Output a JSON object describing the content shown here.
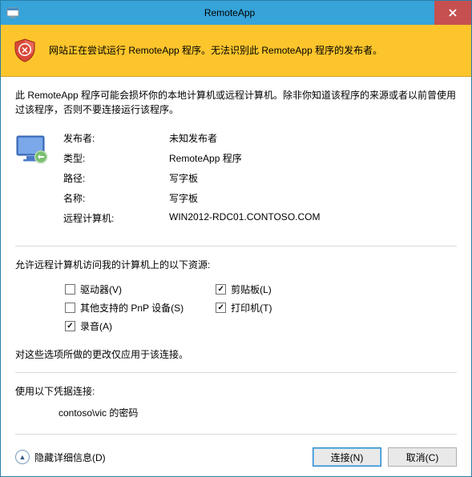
{
  "window": {
    "title": "RemoteApp"
  },
  "warning": {
    "message": "网站正在尝试运行 RemoteApp 程序。无法识别此 RemoteApp 程序的发布者。"
  },
  "description": "此 RemoteApp 程序可能会损坏你的本地计算机或远程计算机。除非你知道该程序的来源或者以前曾使用过该程序，否则不要连接运行该程序。",
  "info": {
    "publisher_label": "发布者:",
    "publisher_value": "未知发布者",
    "type_label": "类型:",
    "type_value": "RemoteApp 程序",
    "path_label": "路径:",
    "path_value": "写字板",
    "name_label": "名称:",
    "name_value": "写字板",
    "remote_label": "远程计算机:",
    "remote_value": "WIN2012-RDC01.CONTOSO.COM"
  },
  "resources": {
    "intro": "允许远程计算机访问我的计算机上的以下资源:",
    "drives": "驱动器(V)",
    "pnp": "其他支持的 PnP 设备(S)",
    "audio": "录音(A)",
    "clipboard": "剪贴板(L)",
    "printers": "打印机(T)",
    "note": "对这些选项所做的更改仅应用于该连接。"
  },
  "credentials": {
    "intro": "使用以下凭据连接:",
    "value": "contoso\\vic 的密码"
  },
  "footer": {
    "details": "隐藏详细信息(D)",
    "connect": "连接(N)",
    "cancel": "取消(C)"
  }
}
